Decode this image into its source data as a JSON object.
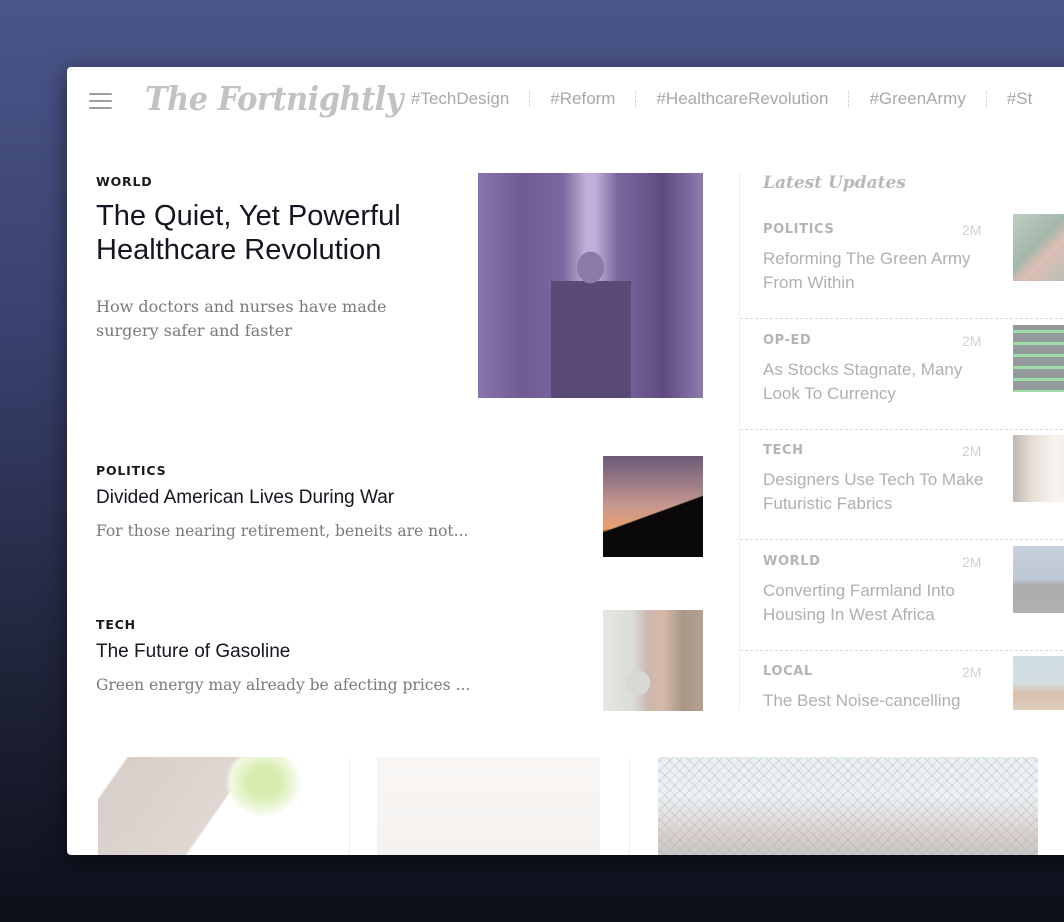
{
  "header": {
    "logo": "The Fortnightly",
    "menu_icon": "hamburger-icon",
    "tags": [
      "#TechDesign",
      "#Reform",
      "#HealthcareRevolution",
      "#GreenArmy",
      "#St"
    ]
  },
  "feature": {
    "category": "WORLD",
    "title": "The Quiet, Yet Powerful Healthcare Revolution",
    "description": "How doctors and nurses have made surgery safer and faster",
    "image": "nurse-in-hallway-photo"
  },
  "articles": [
    {
      "category": "POLITICS",
      "title": "Divided American Lives During War",
      "description": "For those nearing retirement, beneits are not...",
      "image": "american-flags-photo"
    },
    {
      "category": "TECH",
      "title": "The Future of Gasoline",
      "description": "Green energy may already be afecting prices ...",
      "image": "ev-charger-photo"
    }
  ],
  "sidebar": {
    "title": "Latest Updates",
    "updates": [
      {
        "category": "POLITICS",
        "time": "2M",
        "title": "Reforming The Green Army From Within",
        "image": "soldiers-photo"
      },
      {
        "category": "OP-ED",
        "time": "2M",
        "title": "As Stocks Stagnate, Many Look To Currency",
        "image": "stock-board-photo"
      },
      {
        "category": "TECH",
        "time": "2M",
        "title": "Designers Use Tech To Make Futuristic Fabrics",
        "image": "designer-photo"
      },
      {
        "category": "WORLD",
        "time": "2M",
        "title": "Converting Farmland Into Housing In West Africa",
        "image": "house-photo"
      },
      {
        "category": "LOCAL",
        "time": "2M",
        "title": "The Best Noise-cancelling",
        "image": "headphones-photo"
      }
    ]
  },
  "bottom_cards": [
    {
      "image": "cutlery-photo"
    },
    {
      "image": "doorway-photo"
    },
    {
      "image": "fence-photo"
    }
  ]
}
